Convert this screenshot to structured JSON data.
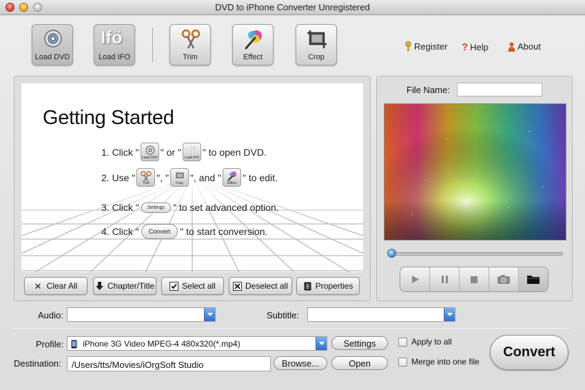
{
  "window": {
    "title": "DVD to iPhone Converter Unregistered"
  },
  "toolbar": {
    "load_dvd": "Load DVD",
    "load_ifo": "Load IFO",
    "trim": "Trim",
    "effect": "Effect",
    "crop": "Crop",
    "ifo_glyph": "Ifö"
  },
  "links": {
    "register": "Register",
    "help": "Help",
    "about": "About"
  },
  "getting_started": {
    "title": "Getting Started",
    "step1": {
      "a": "1. Click \"",
      "b": "\" or \"",
      "c": "\" to open DVD."
    },
    "step2": {
      "a": "2. Use \"",
      "b": "\", \"",
      "c": "\", and \"",
      "d": "\" to edit."
    },
    "step3": {
      "a": "3. Click \"",
      "b": "\" to set advanced option."
    },
    "step4": {
      "a": "4. Click \"",
      "b": "\" to start conversion."
    },
    "mini_settings": "Settings",
    "mini_convert": "Convert",
    "mini_load_dvd": "Load DVD",
    "mini_load_ifo": "Load IFO",
    "mini_trim": "Trim",
    "mini_crop": "Crop",
    "mini_effect": "Effect"
  },
  "list_buttons": {
    "clear_all": "Clear All",
    "chapter_title": "Chapter/Title",
    "select_all": "Select all",
    "deselect_all": "Deselect all",
    "properties": "Properties"
  },
  "preview": {
    "file_name_label": "File Name:",
    "file_name_value": "",
    "progress": 0.0
  },
  "audio": {
    "label": "Audio:",
    "value": ""
  },
  "subtitle": {
    "label": "Subtitle:",
    "value": ""
  },
  "profile": {
    "label": "Profile:",
    "value": "iPhone 3G Video MPEG-4 480x320(*.mp4)"
  },
  "destination": {
    "label": "Destination:",
    "value": "/Users/tts/Movies/iOrgSoft Studio"
  },
  "buttons": {
    "settings": "Settings",
    "browse": "Browse...",
    "open": "Open",
    "convert": "Convert"
  },
  "options": {
    "apply_to_all": "Apply to all",
    "merge": "Merge into one file"
  },
  "colors": {
    "accent_blue": "#2f6fcd",
    "key_gold": "#e0b43a",
    "help_red": "#d8452d",
    "about_orange": "#c8602a"
  }
}
